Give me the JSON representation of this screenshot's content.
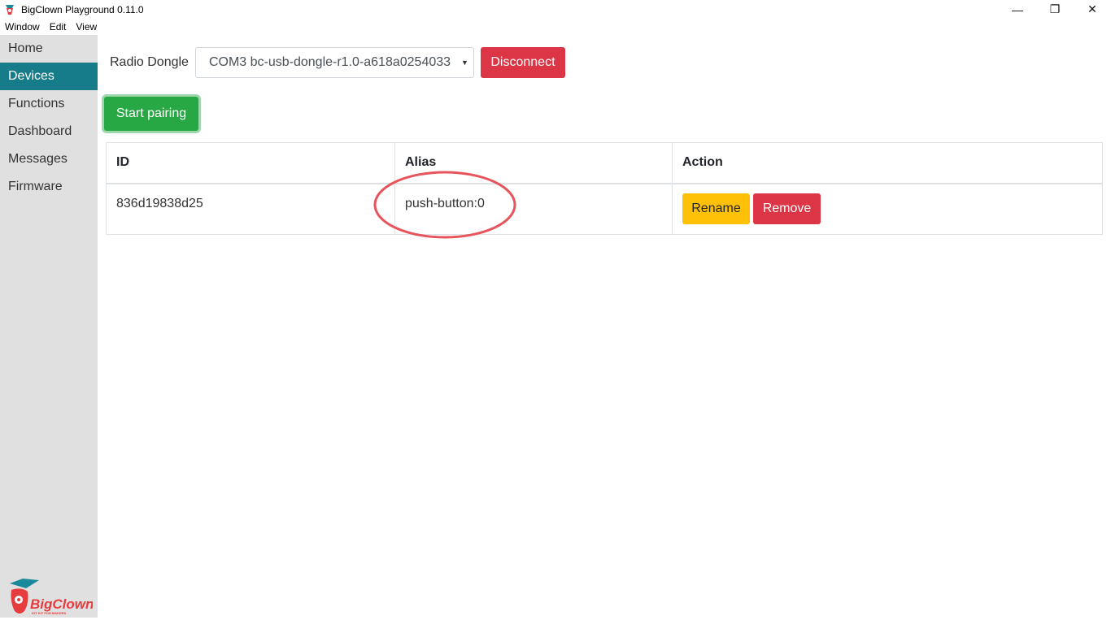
{
  "window": {
    "title": "BigClown Playground 0.11.0",
    "controls": {
      "minimize": "—",
      "restore": "❐",
      "close": "✕"
    }
  },
  "menubar": {
    "items": [
      {
        "label": "Window"
      },
      {
        "label": "Edit"
      },
      {
        "label": "View"
      }
    ]
  },
  "sidebar": {
    "items": [
      {
        "label": "Home",
        "active": false
      },
      {
        "label": "Devices",
        "active": true
      },
      {
        "label": "Functions",
        "active": false
      },
      {
        "label": "Dashboard",
        "active": false
      },
      {
        "label": "Messages",
        "active": false
      },
      {
        "label": "Firmware",
        "active": false
      }
    ],
    "logo_text": "BigClown",
    "logo_tagline": "IOT KIT FOR MAKERS"
  },
  "main": {
    "dongle_label": "Radio Dongle",
    "dongle_selected": "COM3 bc-usb-dongle-r1.0-a618a0254033",
    "disconnect_label": "Disconnect",
    "pairing_label": "Start pairing",
    "table": {
      "headers": [
        "ID",
        "Alias",
        "Action"
      ],
      "rows": [
        {
          "id": "836d19838d25",
          "alias": "push-button:0",
          "rename_label": "Rename",
          "remove_label": "Remove"
        }
      ]
    }
  },
  "colors": {
    "sidebar_active": "#177c8a",
    "danger": "#dc3545",
    "success": "#28a745",
    "warning": "#ffc107",
    "annotation": "#e8545c"
  }
}
